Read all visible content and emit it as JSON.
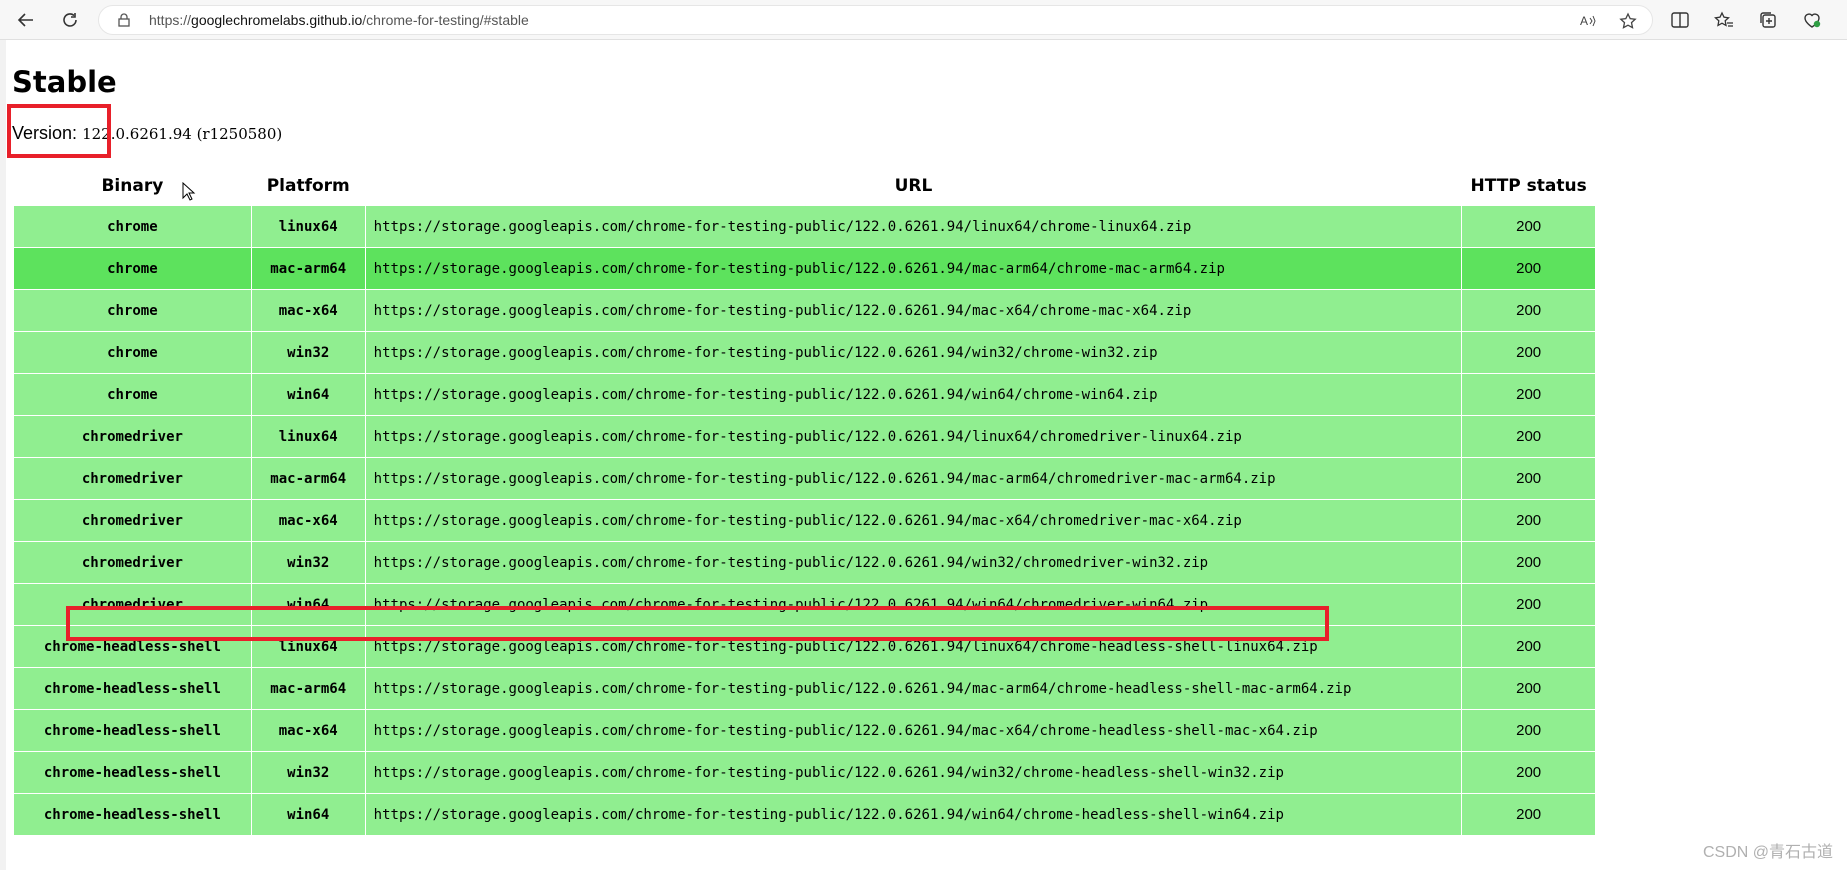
{
  "browser": {
    "url_prefix": "https://",
    "url_host": "googlechromelabs.github.io",
    "url_path": "/chrome-for-testing/#stable"
  },
  "page": {
    "title": "Stable",
    "version_label": "Version:",
    "version_value": "122.0.6261.94 (r1250580)"
  },
  "table": {
    "headers": [
      "Binary",
      "Platform",
      "URL",
      "HTTP status"
    ],
    "rows": [
      {
        "binary": "chrome",
        "platform": "linux64",
        "url": "https://storage.googleapis.com/chrome-for-testing-public/122.0.6261.94/linux64/chrome-linux64.zip",
        "status": "200"
      },
      {
        "binary": "chrome",
        "platform": "mac-arm64",
        "url": "https://storage.googleapis.com/chrome-for-testing-public/122.0.6261.94/mac-arm64/chrome-mac-arm64.zip",
        "status": "200"
      },
      {
        "binary": "chrome",
        "platform": "mac-x64",
        "url": "https://storage.googleapis.com/chrome-for-testing-public/122.0.6261.94/mac-x64/chrome-mac-x64.zip",
        "status": "200"
      },
      {
        "binary": "chrome",
        "platform": "win32",
        "url": "https://storage.googleapis.com/chrome-for-testing-public/122.0.6261.94/win32/chrome-win32.zip",
        "status": "200"
      },
      {
        "binary": "chrome",
        "platform": "win64",
        "url": "https://storage.googleapis.com/chrome-for-testing-public/122.0.6261.94/win64/chrome-win64.zip",
        "status": "200"
      },
      {
        "binary": "chromedriver",
        "platform": "linux64",
        "url": "https://storage.googleapis.com/chrome-for-testing-public/122.0.6261.94/linux64/chromedriver-linux64.zip",
        "status": "200"
      },
      {
        "binary": "chromedriver",
        "platform": "mac-arm64",
        "url": "https://storage.googleapis.com/chrome-for-testing-public/122.0.6261.94/mac-arm64/chromedriver-mac-arm64.zip",
        "status": "200"
      },
      {
        "binary": "chromedriver",
        "platform": "mac-x64",
        "url": "https://storage.googleapis.com/chrome-for-testing-public/122.0.6261.94/mac-x64/chromedriver-mac-x64.zip",
        "status": "200"
      },
      {
        "binary": "chromedriver",
        "platform": "win32",
        "url": "https://storage.googleapis.com/chrome-for-testing-public/122.0.6261.94/win32/chromedriver-win32.zip",
        "status": "200"
      },
      {
        "binary": "chromedriver",
        "platform": "win64",
        "url": "https://storage.googleapis.com/chrome-for-testing-public/122.0.6261.94/win64/chromedriver-win64.zip",
        "status": "200"
      },
      {
        "binary": "chrome-headless-shell",
        "platform": "linux64",
        "url": "https://storage.googleapis.com/chrome-for-testing-public/122.0.6261.94/linux64/chrome-headless-shell-linux64.zip",
        "status": "200"
      },
      {
        "binary": "chrome-headless-shell",
        "platform": "mac-arm64",
        "url": "https://storage.googleapis.com/chrome-for-testing-public/122.0.6261.94/mac-arm64/chrome-headless-shell-mac-arm64.zip",
        "status": "200"
      },
      {
        "binary": "chrome-headless-shell",
        "platform": "mac-x64",
        "url": "https://storage.googleapis.com/chrome-for-testing-public/122.0.6261.94/mac-x64/chrome-headless-shell-mac-x64.zip",
        "status": "200"
      },
      {
        "binary": "chrome-headless-shell",
        "platform": "win32",
        "url": "https://storage.googleapis.com/chrome-for-testing-public/122.0.6261.94/win32/chrome-headless-shell-win32.zip",
        "status": "200"
      },
      {
        "binary": "chrome-headless-shell",
        "platform": "win64",
        "url": "https://storage.googleapis.com/chrome-for-testing-public/122.0.6261.94/win64/chrome-headless-shell-win64.zip",
        "status": "200"
      }
    ]
  },
  "watermark": "CSDN @青石古道",
  "colors": {
    "row_bg": "#90ee90",
    "row_highlight_bg": "#5de25d",
    "annotation_red": "#e8202a"
  },
  "icons": [
    "back-icon",
    "refresh-icon",
    "lock-icon",
    "read-aloud-icon",
    "favorite-star-icon",
    "split-screen-icon",
    "favorites-icon",
    "collections-icon",
    "browser-essentials-icon",
    "cursor-icon"
  ]
}
